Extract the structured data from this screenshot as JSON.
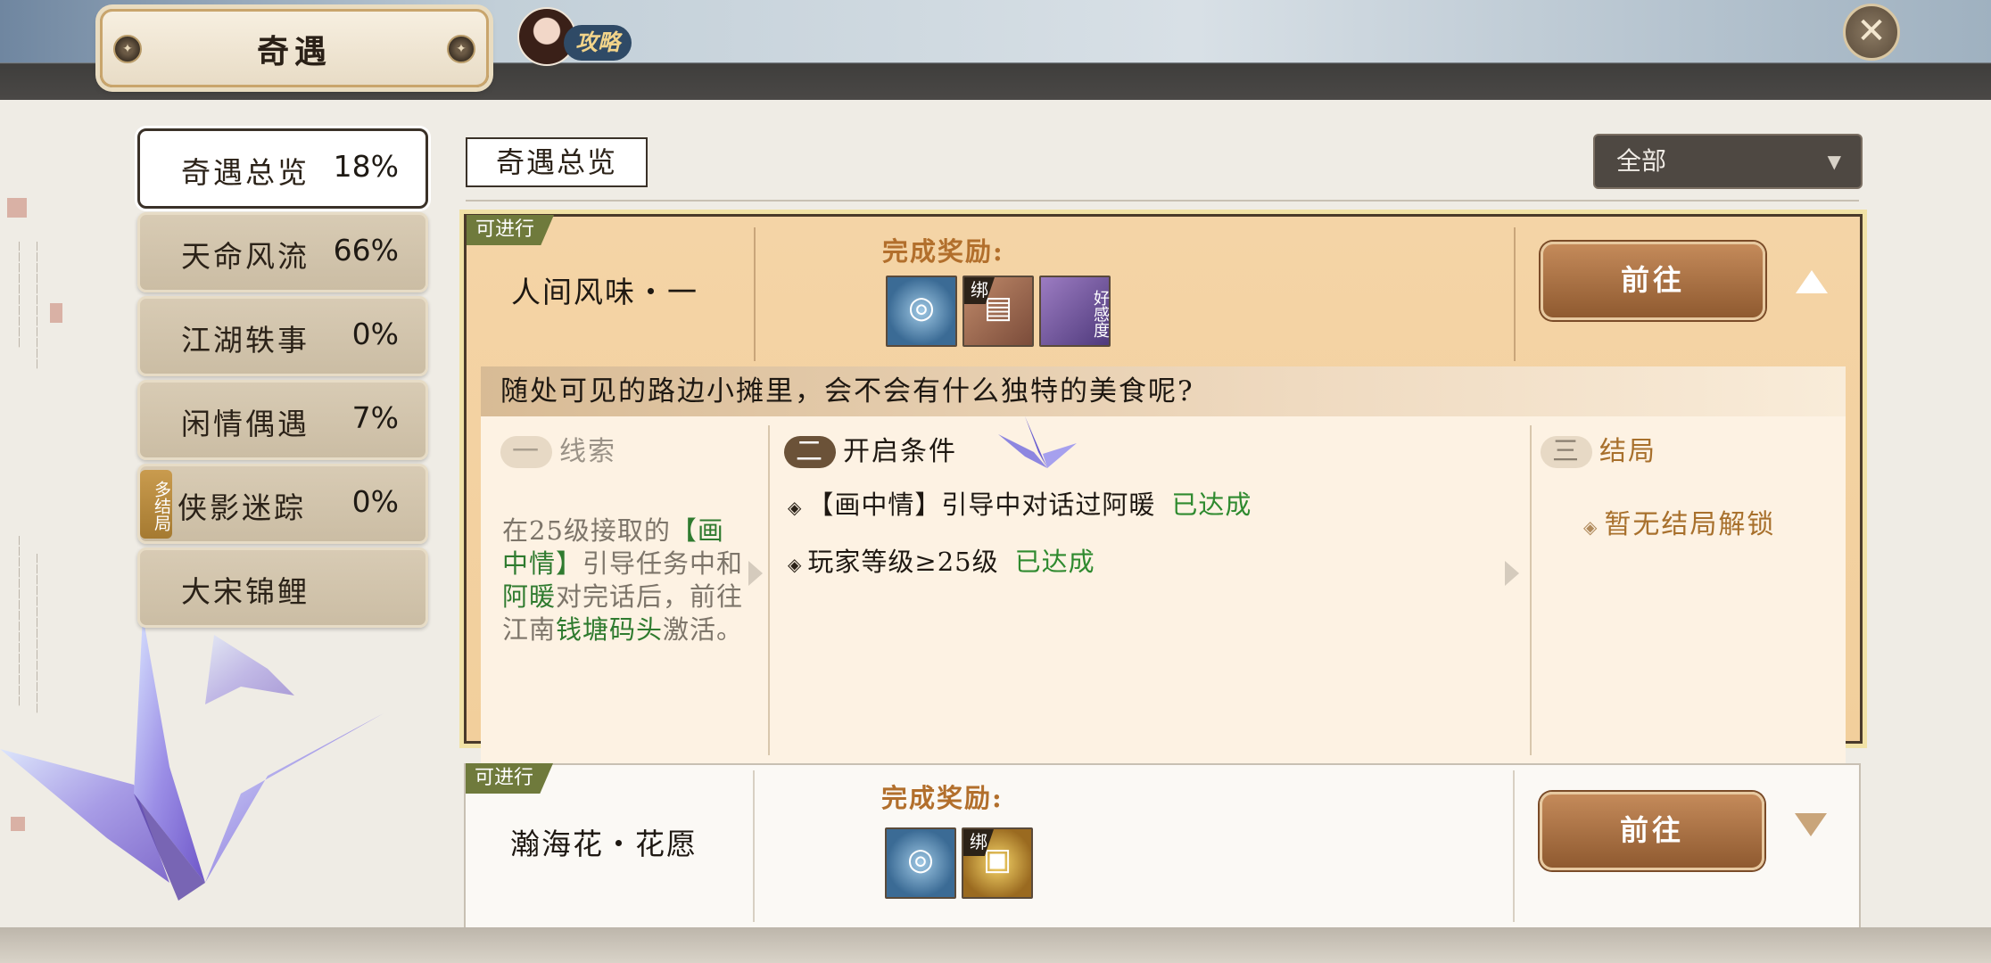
{
  "header": {
    "title": "奇遇",
    "guide_label": "攻略",
    "close_symbol": "✕"
  },
  "nav": {
    "items": [
      {
        "label": "奇遇总览",
        "percent": "18%",
        "active": true
      },
      {
        "label": "天命风流",
        "percent": "66%"
      },
      {
        "label": "江湖轶事",
        "percent": "0%"
      },
      {
        "label": "闲情偶遇",
        "percent": "7%"
      },
      {
        "label": "侠影迷踪",
        "percent": "0%",
        "tag": "多结局"
      },
      {
        "label": "大宋锦鲤",
        "percent": ""
      }
    ]
  },
  "main": {
    "section_tab": "奇遇总览",
    "filter": {
      "value": "全部",
      "arrow": "▼"
    }
  },
  "quests": [
    {
      "status": "可进行",
      "name": "人间风味・一",
      "reward_label": "完成奖励:",
      "rewards": [
        {
          "icon": "token-icon",
          "bound": false
        },
        {
          "icon": "book-icon",
          "bound": true,
          "bind_text": "绑"
        },
        {
          "icon": "favor-icon",
          "bound": false,
          "text": "好感度"
        }
      ],
      "go_label": "前往",
      "description": "随处可见的路边小摊里，会不会有什么独特的美食呢?",
      "clue": {
        "num": "一",
        "title": "线索",
        "t1": "在25级接取的",
        "h1": "【画中情】",
        "t2": "引导任务中和",
        "h2": "阿暖",
        "t3": "对完话后，前往江南",
        "h3": "钱塘码头",
        "t4": "激活。"
      },
      "conditions": {
        "num": "二",
        "title": "开启条件",
        "items": [
          {
            "text": "【画中情】引导中对话过阿暖",
            "status": "已达成"
          },
          {
            "text": "玩家等级≥25级",
            "status": "已达成"
          }
        ]
      },
      "ending": {
        "num": "三",
        "title": "结局",
        "text": "暂无结局解锁"
      }
    },
    {
      "status": "可进行",
      "name": "瀚海花・花愿",
      "reward_label": "完成奖励:",
      "rewards": [
        {
          "icon": "token-icon",
          "bound": false
        },
        {
          "icon": "treasure-chest-icon",
          "bound": true,
          "bind_text": "绑"
        }
      ],
      "go_label": "前往"
    }
  ],
  "colors": {
    "accent_green": "#2f8a2f",
    "reward_orange": "#b26f2c",
    "badge_olive": "#6f7a3c"
  }
}
